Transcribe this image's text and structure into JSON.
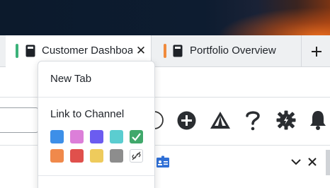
{
  "tabs": [
    {
      "label": "Customer Dashboard",
      "color": "#3bb27a",
      "active": true
    },
    {
      "label": "Portfolio Overview",
      "color": "#f08a3c",
      "active": false
    }
  ],
  "icons": {
    "close": "close-icon",
    "add_tab": "plus-icon",
    "add_circle": "add-circle-icon",
    "triangle": "triangle-logo-icon",
    "help": "question-mark-icon",
    "settings": "gear-icon",
    "notifications": "bell-icon"
  },
  "context_menu": {
    "new_tab_label": "New Tab",
    "link_channel_label": "Link to Channel",
    "swatches": [
      {
        "color": "#3d8fe8",
        "selected": false
      },
      {
        "color": "#dc7fd9",
        "selected": false
      },
      {
        "color": "#6b5cf0",
        "selected": false
      },
      {
        "color": "#5bcdd0",
        "selected": false
      },
      {
        "color": "#40a86b",
        "selected": true
      },
      {
        "color": "#f0894b",
        "selected": false
      },
      {
        "color": "#e0504c",
        "selected": false
      },
      {
        "color": "#eecb5c",
        "selected": false
      },
      {
        "color": "#8d8d8d",
        "selected": false
      },
      {
        "color": "#ffffff",
        "selected": false,
        "unlink": true
      }
    ]
  }
}
